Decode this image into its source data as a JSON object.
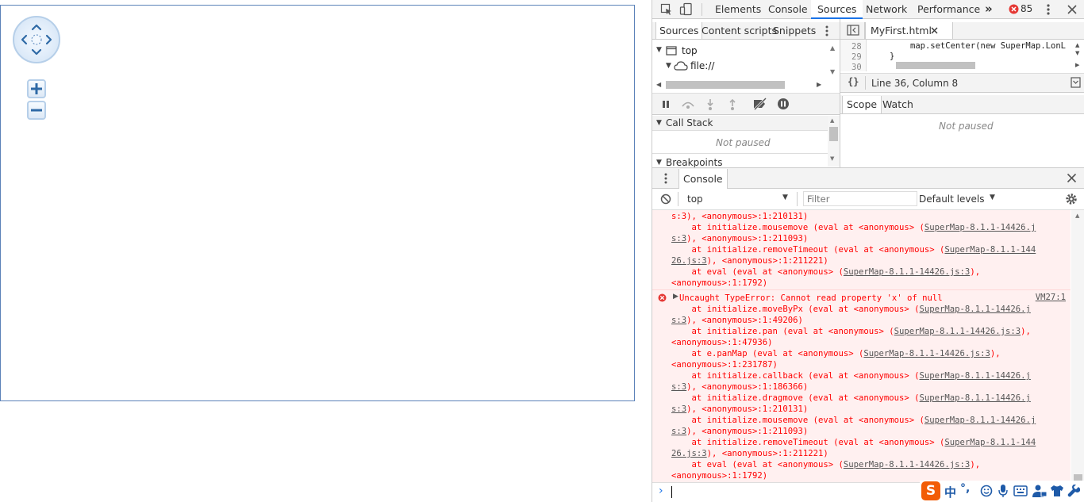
{
  "devtools": {
    "toolbar": {
      "tabs": [
        "Elements",
        "Console",
        "Sources",
        "Network",
        "Performance"
      ],
      "active_tab": "Sources",
      "more": "»",
      "error_count": "85"
    },
    "sources": {
      "navigator_tabs": [
        "Sources",
        "Content scripts",
        "Snippets"
      ],
      "tree": [
        "top",
        "file://"
      ],
      "file_tab": "MyFirst.html",
      "line_numbers": [
        "28",
        "29",
        "30"
      ],
      "code_line": "map.setCenter(new SuperMap.LonL",
      "code_line_2": "}",
      "format_icon": "{}",
      "cursor_position": "Line 36, Column 8"
    },
    "debugger": {
      "call_stack_label": "Call Stack",
      "call_stack_status": "Not paused",
      "breakpoints_label": "Breakpoints",
      "scope_tabs": [
        "Scope",
        "Watch"
      ],
      "scope_status": "Not paused"
    },
    "console": {
      "tab": "Console",
      "context": "top",
      "filter_placeholder": "Filter",
      "levels": "Default levels",
      "top_block": [
        [
          "s:3), <anonymous>:1:210131)",
          ""
        ],
        [
          "    at initialize.mousemove (eval at <anonymous> (",
          "SuperMap-8.1.1-14426.j"
        ],
        [
          "s:3",
          "), <anonymous>:1:211093)"
        ],
        [
          "    at initialize.removeTimeout (eval at <anonymous> (",
          "SuperMap-8.1.1-144"
        ],
        [
          "26.js:3",
          "), <anonymous>:1:211221)"
        ],
        [
          "    at eval (eval at <anonymous> (",
          "SuperMap-8.1.1-14426.js:3",
          "),"
        ],
        [
          "<anonymous>:1:1792)",
          ""
        ]
      ],
      "error_message": "Uncaught TypeError: Cannot read property 'x' of null",
      "error_source": "VM27:1",
      "error_stack": [
        [
          "    at initialize.moveByPx (eval at <anonymous> (",
          "SuperMap-8.1.1-14426.j"
        ],
        [
          "s:3",
          "), <anonymous>:1:49206)"
        ],
        [
          "    at initialize.pan (eval at <anonymous> (",
          "SuperMap-8.1.1-14426.js:3",
          "),"
        ],
        [
          "<anonymous>:1:47936)",
          ""
        ],
        [
          "    at e.panMap (eval at <anonymous> (",
          "SuperMap-8.1.1-14426.js:3",
          "),"
        ],
        [
          "<anonymous>:1:231787)",
          ""
        ],
        [
          "    at initialize.callback (eval at <anonymous> (",
          "SuperMap-8.1.1-14426.j"
        ],
        [
          "s:3",
          "), <anonymous>:1:186366)"
        ],
        [
          "    at initialize.dragmove (eval at <anonymous> (",
          "SuperMap-8.1.1-14426.j"
        ],
        [
          "s:3",
          "), <anonymous>:1:210131)"
        ],
        [
          "    at initialize.mousemove (eval at <anonymous> (",
          "SuperMap-8.1.1-14426.j"
        ],
        [
          "s:3",
          "), <anonymous>:1:211093)"
        ],
        [
          "    at initialize.removeTimeout (eval at <anonymous> (",
          "SuperMap-8.1.1-144"
        ],
        [
          "26.js:3",
          "), <anonymous>:1:211221)"
        ],
        [
          "    at eval (eval at <anonymous> (",
          "SuperMap-8.1.1-14426.js:3",
          "),"
        ],
        [
          "<anonymous>:1:1792)",
          ""
        ]
      ],
      "prompt": "›"
    },
    "ime_bar": {
      "logo": "S",
      "lang": "中",
      "punct": "°,"
    }
  },
  "colors": {
    "accent": "#1a73e8",
    "error_red": "#ff0000",
    "error_bg": "#fff0f0",
    "map_border": "#5b82b8",
    "ime_orange": "#f25c05"
  }
}
